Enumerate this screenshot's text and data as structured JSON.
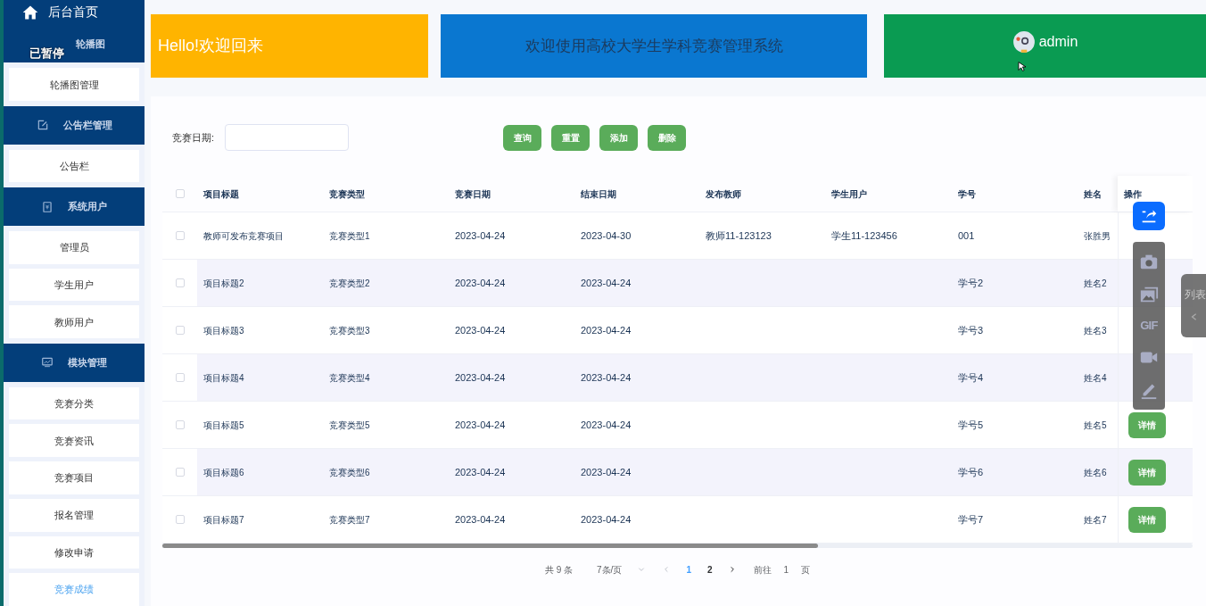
{
  "sidebar": {
    "home": "后台首页",
    "groups": [
      {
        "title": "轮播图",
        "items": [
          {
            "label": "轮播图管理",
            "selected": false
          }
        ]
      },
      {
        "title": "公告栏管理",
        "items": [
          {
            "label": "公告栏",
            "selected": false
          }
        ]
      },
      {
        "title": "系统用户",
        "items": [
          {
            "label": "管理员",
            "selected": false
          },
          {
            "label": "学生用户",
            "selected": false
          },
          {
            "label": "教师用户",
            "selected": false
          }
        ]
      },
      {
        "title": "模块管理",
        "items": [
          {
            "label": "竞赛分类",
            "selected": false
          },
          {
            "label": "竞赛资讯",
            "selected": false
          },
          {
            "label": "竞赛项目",
            "selected": false
          },
          {
            "label": "报名管理",
            "selected": false
          },
          {
            "label": "修改申请",
            "selected": false
          },
          {
            "label": "竞赛成绩",
            "selected": true
          }
        ]
      }
    ]
  },
  "banner": {
    "greeting": "Hello!欢迎回来",
    "system_title": "欢迎使用高校大学生学科竞赛管理系统",
    "user": "admin"
  },
  "search": {
    "label": "竞赛日期:",
    "buttons": [
      "查询",
      "重置",
      "添加",
      "删除"
    ]
  },
  "table": {
    "select_all": {
      "checked": false
    },
    "columns": [
      "项目标题",
      "竞赛类型",
      "竞赛日期",
      "结束日期",
      "发布教师",
      "学生用户",
      "学号",
      "姓名",
      "操作"
    ],
    "rows": [
      {
        "checked": false,
        "cells": [
          "教师可发布竞赛项目",
          "竞赛类型1",
          "2023-04-24",
          "2023-04-30",
          "教师11-123123",
          "学生11-123456",
          "001",
          "张胜男"
        ]
      },
      {
        "checked": false,
        "cells": [
          "项目标题2",
          "竞赛类型2",
          "2023-04-24",
          "2023-04-24",
          null,
          null,
          "学号2",
          "姓名2"
        ]
      },
      {
        "checked": false,
        "cells": [
          "项目标题3",
          "竞赛类型3",
          "2023-04-24",
          "2023-04-24",
          null,
          null,
          "学号3",
          "姓名3"
        ]
      },
      {
        "checked": false,
        "cells": [
          "项目标题4",
          "竞赛类型4",
          "2023-04-24",
          "2023-04-24",
          null,
          null,
          "学号4",
          "姓名4"
        ]
      },
      {
        "checked": false,
        "cells": [
          "项目标题5",
          "竞赛类型5",
          "2023-04-24",
          "2023-04-24",
          null,
          null,
          "学号5",
          "姓名5"
        ],
        "action": "详情"
      },
      {
        "checked": false,
        "cells": [
          "项目标题6",
          "竞赛类型6",
          "2023-04-24",
          "2023-04-24",
          null,
          null,
          "学号6",
          "姓名6"
        ],
        "action": "详情"
      },
      {
        "checked": false,
        "cells": [
          "项目标题7",
          "竞赛类型7",
          "2023-04-24",
          "2023-04-24",
          null,
          null,
          "学号7",
          "姓名7"
        ],
        "action": "详情"
      }
    ]
  },
  "pagination": {
    "total": "共 9 条",
    "page_size": "7条/页",
    "pages": [
      {
        "label": "1",
        "selected": true
      },
      {
        "label": "2",
        "selected": false
      }
    ],
    "goto_label": "前往",
    "goto_value": "1",
    "goto_suffix": "页"
  },
  "recorder": {
    "status": "已暂停",
    "side_panel": "列表",
    "tools": [
      {
        "kind": "share"
      },
      {
        "kind": "camera"
      },
      {
        "kind": "image"
      },
      {
        "kind": "gif",
        "label": "GIF"
      },
      {
        "kind": "video"
      },
      {
        "kind": "pen"
      }
    ]
  }
}
